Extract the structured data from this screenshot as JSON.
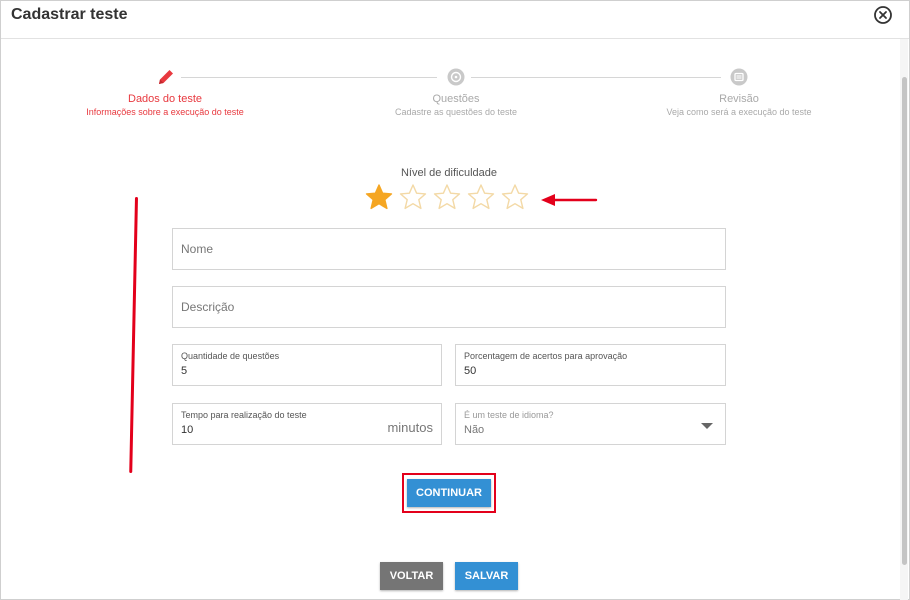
{
  "dialog": {
    "title": "Cadastrar teste"
  },
  "stepper": {
    "steps": [
      {
        "title": "Dados do teste",
        "subtitle": "Informações sobre a execução do teste",
        "icon": "pencil-icon",
        "state": "active"
      },
      {
        "title": "Questões",
        "subtitle": "Cadastre as questões do teste",
        "icon": "question-icon",
        "state": "inactive"
      },
      {
        "title": "Revisão",
        "subtitle": "Veja como será a execução do teste",
        "icon": "review-icon",
        "state": "inactive"
      }
    ]
  },
  "rating": {
    "label": "Nível de dificuldade",
    "value": 1,
    "max": 5
  },
  "form": {
    "nome_placeholder": "Nome",
    "descricao_placeholder": "Descrição",
    "quantidade": {
      "label": "Quantidade de questões",
      "value": "5"
    },
    "porcentagem": {
      "label": "Porcentagem de acertos para aprovação",
      "value": "50"
    },
    "tempo": {
      "label": "Tempo para realização do teste",
      "value": "10",
      "suffix": "minutos"
    },
    "idioma": {
      "label": "É um teste de idioma?",
      "value": "Não"
    }
  },
  "buttons": {
    "continuar": "CONTINUAR",
    "voltar": "VOLTAR",
    "salvar": "SALVAR"
  },
  "colors": {
    "accent_red": "#e8393f",
    "primary_blue": "#3390d4",
    "star_filled": "#f5a623",
    "star_empty": "#f3d9a6",
    "annotation_red": "#e3001b"
  }
}
